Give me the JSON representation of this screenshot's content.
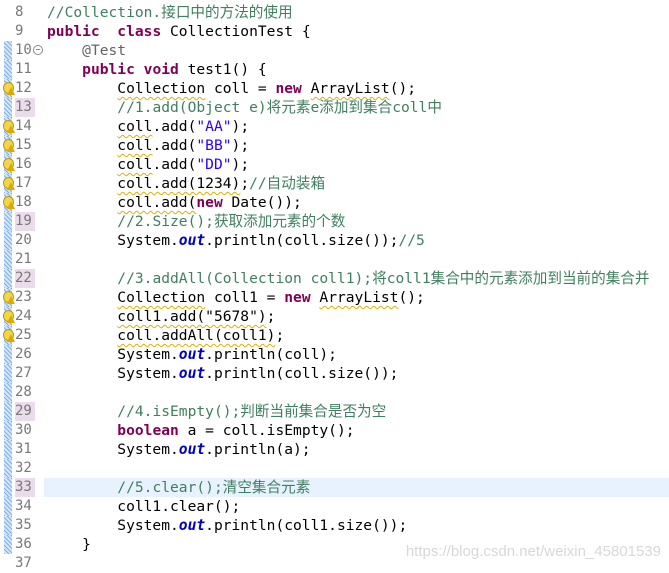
{
  "editor": {
    "lines": [
      {
        "n": "8",
        "t": [
          [
            "cm",
            "//Collection.接口中的方法的使用"
          ]
        ]
      },
      {
        "n": "9",
        "t": [
          [
            "kw",
            "public"
          ],
          [
            "",
            "  "
          ],
          [
            "kw",
            "class"
          ],
          [
            "",
            " CollectionTest {"
          ]
        ]
      },
      {
        "n": "10",
        "fold": true,
        "t": [
          [
            "",
            "    "
          ],
          [
            "ann",
            "@Test"
          ]
        ]
      },
      {
        "n": "11",
        "t": [
          [
            "",
            "    "
          ],
          [
            "kw",
            "public"
          ],
          [
            "",
            " "
          ],
          [
            "kw",
            "void"
          ],
          [
            "",
            " test1() {"
          ]
        ]
      },
      {
        "n": "12",
        "warn": true,
        "t": [
          [
            "",
            "        "
          ],
          [
            "sq",
            "Collection"
          ],
          [
            "",
            " coll = "
          ],
          [
            "kw",
            "new"
          ],
          [
            "",
            " "
          ],
          [
            "sq",
            "ArrayList"
          ],
          [
            "",
            "();"
          ]
        ]
      },
      {
        "n": "13",
        "mark": true,
        "t": [
          [
            "",
            "        "
          ],
          [
            "cm",
            "//1.add(Object e)将元素e添加到集合coll中"
          ]
        ]
      },
      {
        "n": "14",
        "warn": true,
        "t": [
          [
            "",
            "        "
          ],
          [
            "sq",
            "coll"
          ],
          [
            ".add(",
            ""
          ],
          [
            "str",
            "\"AA\""
          ],
          [
            "",
            ");"
          ]
        ]
      },
      {
        "n": "15",
        "warn": true,
        "t": [
          [
            "",
            "        "
          ],
          [
            "sq",
            "coll"
          ],
          [
            "",
            ".add("
          ],
          [
            "str",
            "\"BB\""
          ],
          [
            "",
            ");"
          ]
        ]
      },
      {
        "n": "16",
        "warn": true,
        "t": [
          [
            "",
            "        "
          ],
          [
            "sq",
            "coll"
          ],
          [
            "",
            ".add("
          ],
          [
            "str",
            "\"DD\""
          ],
          [
            "",
            ");"
          ]
        ]
      },
      {
        "n": "17",
        "warn": true,
        "t": [
          [
            "",
            "        "
          ],
          [
            "sq",
            "coll.add(1234)"
          ],
          [
            "",
            ";"
          ],
          [
            "cm",
            "//自动装箱"
          ]
        ]
      },
      {
        "n": "18",
        "warn": true,
        "t": [
          [
            "",
            "        "
          ],
          [
            "sq",
            "coll.add("
          ],
          [
            "kw",
            "new"
          ],
          [
            "",
            " Date());"
          ]
        ]
      },
      {
        "n": "19",
        "mark": true,
        "t": [
          [
            "",
            "        "
          ],
          [
            "cm",
            "//2.Size();获取添加元素的个数"
          ]
        ]
      },
      {
        "n": "20",
        "t": [
          [
            "",
            "        System."
          ],
          [
            "fld",
            "out"
          ],
          [
            "",
            ".println(coll.size());"
          ],
          [
            "cm",
            "//5"
          ]
        ]
      },
      {
        "n": "21",
        "t": []
      },
      {
        "n": "22",
        "mark": true,
        "t": [
          [
            "",
            "        "
          ],
          [
            "cm",
            "//3.addAll(Collection coll1);将coll1集合中的元素添加到当前的集合并"
          ]
        ]
      },
      {
        "n": "23",
        "warn": true,
        "t": [
          [
            "",
            "        "
          ],
          [
            "sq",
            "Collection"
          ],
          [
            "",
            " coll1 = "
          ],
          [
            "kw",
            "new"
          ],
          [
            "",
            " "
          ],
          [
            "sq",
            "ArrayList"
          ],
          [
            "",
            "();"
          ]
        ]
      },
      {
        "n": "24",
        "warn": true,
        "t": [
          [
            "",
            "        "
          ],
          [
            "sq",
            "coll1.add(\"5678\")"
          ],
          [
            "",
            ";"
          ]
        ]
      },
      {
        "n": "25",
        "warn": true,
        "t": [
          [
            "",
            "        "
          ],
          [
            "sq",
            "coll.addAll(coll1)"
          ],
          [
            "",
            ";"
          ]
        ]
      },
      {
        "n": "26",
        "t": [
          [
            "",
            "        System."
          ],
          [
            "fld",
            "out"
          ],
          [
            "",
            ".println(coll);"
          ]
        ]
      },
      {
        "n": "27",
        "t": [
          [
            "",
            "        System."
          ],
          [
            "fld",
            "out"
          ],
          [
            "",
            ".println(coll.size());"
          ]
        ]
      },
      {
        "n": "28",
        "t": []
      },
      {
        "n": "29",
        "mark": true,
        "t": [
          [
            "",
            "        "
          ],
          [
            "cm",
            "//4.isEmpty();判断当前集合是否为空"
          ]
        ]
      },
      {
        "n": "30",
        "t": [
          [
            "",
            "        "
          ],
          [
            "kw",
            "boolean"
          ],
          [
            "",
            " a = coll.isEmpty();"
          ]
        ]
      },
      {
        "n": "31",
        "t": [
          [
            "",
            "        System."
          ],
          [
            "fld",
            "out"
          ],
          [
            "",
            ".println(a);"
          ]
        ]
      },
      {
        "n": "32",
        "t": []
      },
      {
        "n": "33",
        "mark": true,
        "current": true,
        "t": [
          [
            "",
            "        "
          ],
          [
            "cm",
            "//5.clear();清空集合元素"
          ]
        ]
      },
      {
        "n": "34",
        "t": [
          [
            "",
            "        coll1.clear();"
          ]
        ]
      },
      {
        "n": "35",
        "t": [
          [
            "",
            "        System."
          ],
          [
            "fld",
            "out"
          ],
          [
            "",
            ".println(coll1.size());"
          ]
        ]
      },
      {
        "n": "36",
        "t": [
          [
            "",
            "    }"
          ]
        ]
      },
      {
        "n": "37",
        "t": []
      }
    ]
  },
  "watermark": "https://blog.csdn.net/weixin_45801539"
}
